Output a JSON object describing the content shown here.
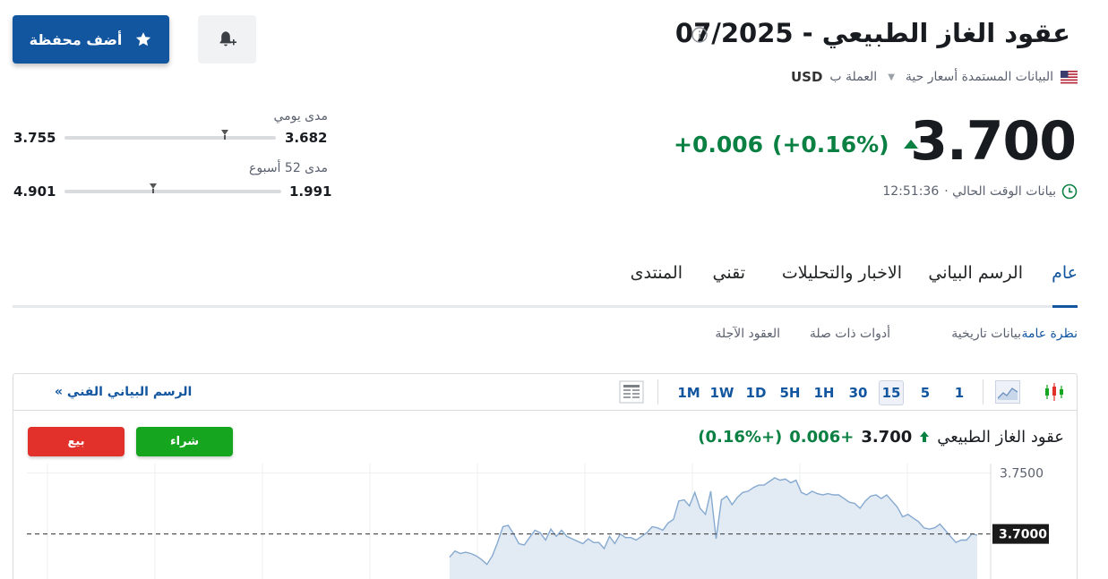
{
  "header": {
    "title": "عقود الغاز الطبيعي - 07/2025",
    "add_portfolio_label": "أضف محفظة",
    "data_source_label": "البيانات المستمدة أسعار حية",
    "currency_prefix": "العملة ب",
    "currency": "USD"
  },
  "quote": {
    "price": "3.700",
    "change": "+0.006",
    "change_pct": "(+0.16%)",
    "time_label": "بيانات الوقت الحالي ·",
    "time": "12:51:36"
  },
  "ranges": {
    "daily": {
      "label": "مدى يومي",
      "low": "3.682",
      "high": "3.755",
      "position": 0.24
    },
    "week52": {
      "label": "مدى 52 أسبوع",
      "low": "1.991",
      "high": "4.901",
      "position": 0.59
    }
  },
  "tabs": [
    {
      "label": "عام",
      "active": true
    },
    {
      "label": "الرسم البياني",
      "active": false
    },
    {
      "label": "الاخبار والتحليلات",
      "active": false
    },
    {
      "label": "تقني",
      "active": false
    },
    {
      "label": "المنتدى",
      "active": false
    }
  ],
  "subtabs": [
    {
      "label": "نظرة عامة",
      "active": true
    },
    {
      "label": "بيانات تاريخية",
      "active": false
    },
    {
      "label": "أدوات ذات صلة",
      "active": false
    },
    {
      "label": "العقود الآجلة",
      "active": false
    }
  ],
  "chart_toolbar": {
    "tech_chart_link": "الرسم البياني الفني »",
    "timeframes": [
      "1",
      "5",
      "15",
      "30",
      "1H",
      "5H",
      "1D",
      "1W",
      "1M"
    ],
    "active_timeframe": "15"
  },
  "chart_widget": {
    "name": "عقود الغاز الطبيعي",
    "price": "3.700",
    "change": "+0.006",
    "change_pct": "(+0.16%)",
    "buy_label": "شراء",
    "sell_label": "بيع"
  },
  "colors": {
    "brand": "#1256a0",
    "positive": "#0a8043",
    "buy": "#16a51f",
    "sell": "#e2312a"
  },
  "chart_data": {
    "type": "area",
    "y_tick_labels": [
      "3.7500"
    ],
    "current_price_label": "3.7000",
    "reference_line": 3.7,
    "ylim": [
      3.655,
      3.765
    ],
    "values": [
      3.681,
      3.686,
      3.684,
      3.685,
      3.684,
      3.682,
      3.679,
      3.675,
      3.682,
      3.693,
      3.706,
      3.707,
      3.7,
      3.692,
      3.691,
      3.697,
      3.703,
      3.701,
      3.695,
      3.704,
      3.698,
      3.703,
      3.698,
      3.696,
      3.694,
      3.692,
      3.696,
      3.693,
      3.693,
      3.688,
      3.698,
      3.692,
      3.7,
      3.697,
      3.697,
      3.695,
      3.698,
      3.701,
      3.706,
      3.705,
      3.703,
      3.709,
      3.712,
      3.727,
      3.728,
      3.723,
      3.734,
      3.721,
      3.716,
      3.735,
      3.696,
      3.728,
      3.731,
      3.724,
      3.73,
      3.734,
      3.735,
      3.738,
      3.74,
      3.74,
      3.743,
      3.746,
      3.744,
      3.745,
      3.742,
      3.744,
      3.734,
      3.732,
      3.735,
      3.733,
      3.732,
      3.733,
      3.732,
      3.732,
      3.729,
      3.726,
      3.725,
      3.721,
      3.727,
      3.731,
      3.732,
      3.729,
      3.732,
      3.727,
      3.722,
      3.714,
      3.716,
      3.713,
      3.71,
      3.705,
      3.704,
      3.705,
      3.708,
      3.703,
      3.698,
      3.693,
      3.695,
      3.695,
      3.7,
      3.699
    ]
  }
}
